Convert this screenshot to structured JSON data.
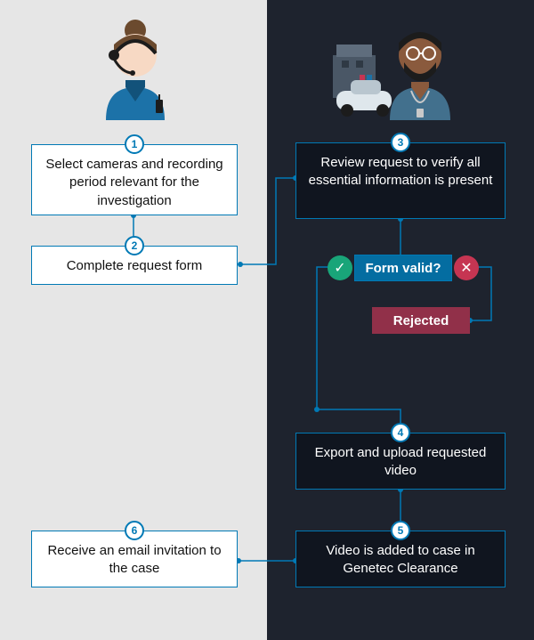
{
  "personas": {
    "requester": {
      "label": "requester-operator"
    },
    "reviewer": {
      "label": "reviewer-officer"
    }
  },
  "steps": {
    "s1": {
      "num": "1",
      "text": "Select cameras and recording  period relevant for the investigation"
    },
    "s2": {
      "num": "2",
      "text": "Complete request form"
    },
    "s3": {
      "num": "3",
      "text": "Review request to verify all essential information is present"
    },
    "s4": {
      "num": "4",
      "text": "Export and upload requested video"
    },
    "s5": {
      "num": "5",
      "text": "Video is added to case in Genetec Clearance"
    },
    "s6": {
      "num": "6",
      "text": "Receive an email invitation to the case"
    }
  },
  "decision": {
    "question": "Form valid?"
  },
  "rejected": {
    "label": "Rejected"
  },
  "icons": {
    "yes": "✓",
    "no": "✕"
  }
}
